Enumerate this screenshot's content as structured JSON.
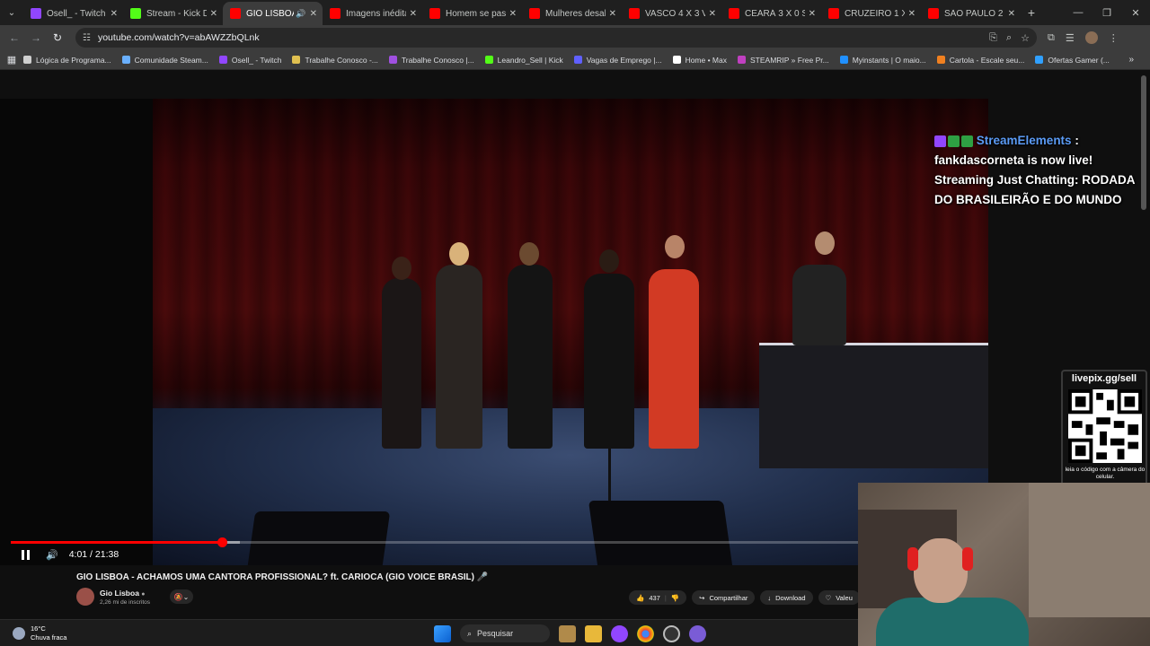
{
  "browser": {
    "tabs": [
      {
        "title": "Osell_ - Twitch",
        "favicon_color": "#9146ff",
        "active": false
      },
      {
        "title": "Stream - Kick Das",
        "favicon_color": "#53fc18",
        "active": false
      },
      {
        "title": "GIO LISBOA -",
        "favicon_color": "#ff0000",
        "active": true,
        "audio": true
      },
      {
        "title": "Imagens inéditas",
        "favicon_color": "#ff0000",
        "active": false
      },
      {
        "title": "Homem se passa",
        "favicon_color": "#ff0000",
        "active": false
      },
      {
        "title": "Mulheres desabri",
        "favicon_color": "#ff0000",
        "active": false
      },
      {
        "title": "VASCO 4 X 3 VITÓ",
        "favicon_color": "#ff0000",
        "active": false
      },
      {
        "title": "CEARÁ 3 X 0 SAN",
        "favicon_color": "#ff0000",
        "active": false
      },
      {
        "title": "CRUZEIRO 1 X 1 S",
        "favicon_color": "#ff0000",
        "active": false
      },
      {
        "title": "SÃO PAULO 2 X 3",
        "favicon_color": "#ff0000",
        "active": false
      }
    ],
    "url": "youtube.com/watch?v=abAWZZbQLnk",
    "bookmarks": [
      {
        "label": "Lógica de Programa...",
        "color": "#cfcfcf"
      },
      {
        "label": "Comunidade Steam...",
        "color": "#6ab0ff"
      },
      {
        "label": "Osell_ - Twitch",
        "color": "#9146ff"
      },
      {
        "label": "Trabalhe Conosco -...",
        "color": "#e0c050"
      },
      {
        "label": "Trabalhe Conosco |...",
        "color": "#a050e0"
      },
      {
        "label": "Leandro_Sell | Kick",
        "color": "#53fc18"
      },
      {
        "label": "Vagas de Emprego |...",
        "color": "#6060ff"
      },
      {
        "label": "Home • Max",
        "color": "#ffffff"
      },
      {
        "label": "STEAMRIP » Free Pr...",
        "color": "#c040c0"
      },
      {
        "label": "Myinstants | O maio...",
        "color": "#2090ff"
      },
      {
        "label": "Cartola - Escale seu...",
        "color": "#f08020"
      },
      {
        "label": "Ofertas Gamer (...",
        "color": "#30a0ff"
      }
    ]
  },
  "overlay": {
    "streamer_name": "StreamElements",
    "message_line": "fankdascorneta is now live!",
    "stream_line": "Streaming Just Chatting: RODADA DO BRASILEIRÃO E DO MUNDO",
    "qr_title": "livepix.gg/sell",
    "qr_hint": "leia o código com a câmera do celular."
  },
  "player": {
    "time_display": "4:01 / 21:38",
    "progress_fraction": 0.2489,
    "loaded_fraction": 0.27
  },
  "video": {
    "title": "GIO LISBOA - ACHAMOS UMA CANTORA PROFISSIONAL? ft. CARIOCA (GIO VOICE BRASIL) 🎤",
    "channel": "Gio Lisboa",
    "verified_mark": "●",
    "subscribers": "2,26 mi de inscritos",
    "likes": "437",
    "share_label": "Compartilhar",
    "download_label": "Download",
    "thanks_label": "Valeu"
  },
  "taskbar": {
    "temp": "16°C",
    "weather": "Chuva fraca",
    "search_label": "Pesquisar"
  },
  "colors": {
    "accent": "#ff0000",
    "overlay_name": "#5b9bf5"
  }
}
